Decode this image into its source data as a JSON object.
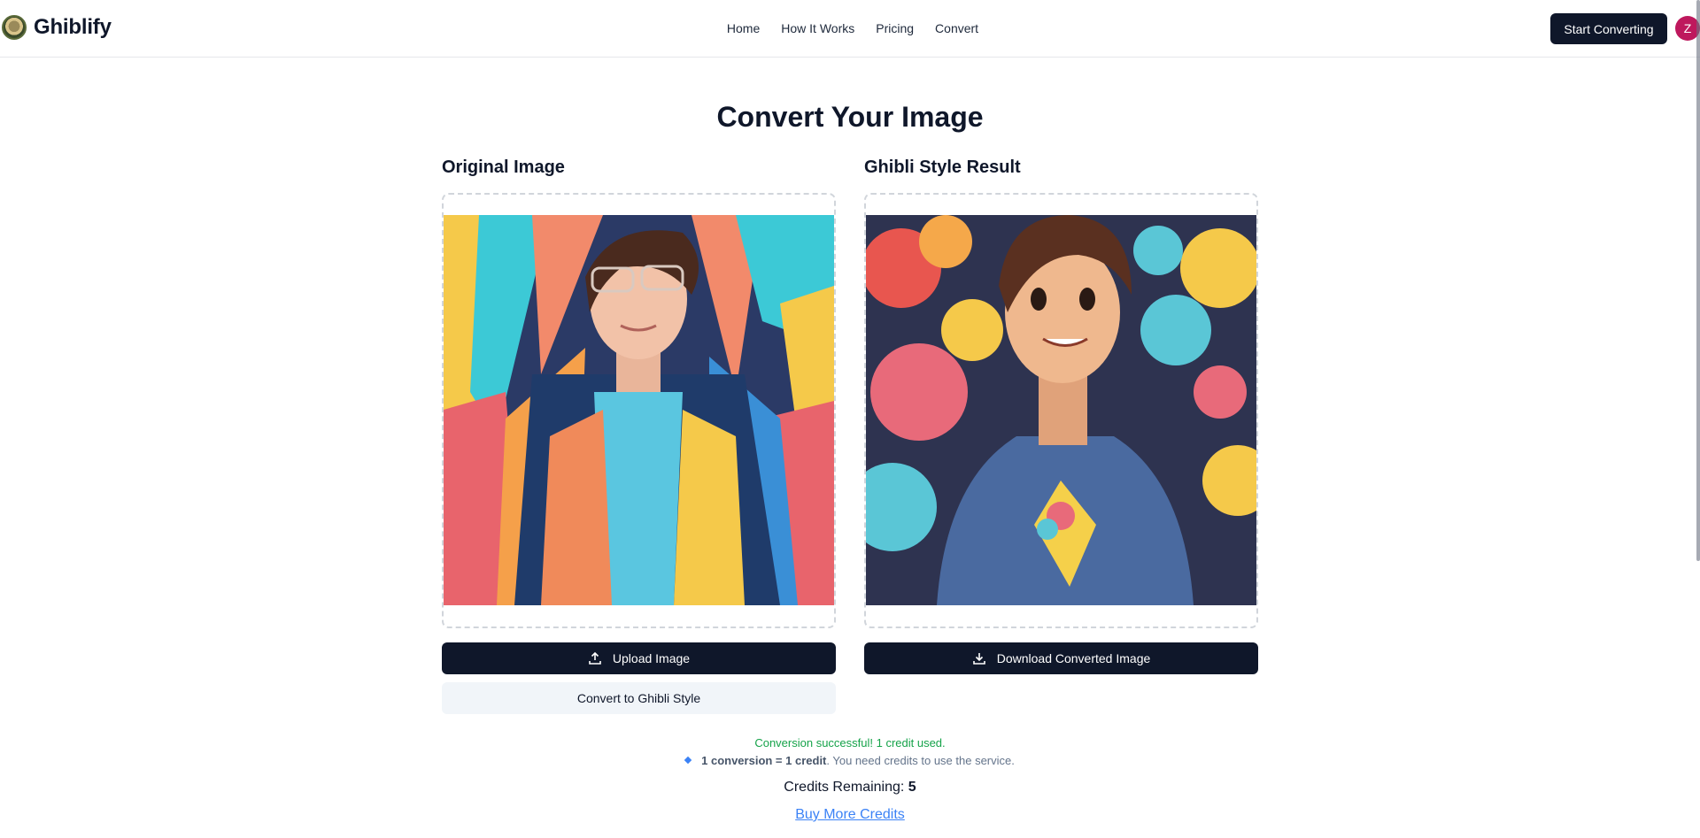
{
  "header": {
    "brand": "Ghiblify",
    "nav": [
      "Home",
      "How It Works",
      "Pricing",
      "Convert"
    ],
    "cta_label": "Start Converting",
    "avatar_initial": "Z"
  },
  "main": {
    "title": "Convert Your Image",
    "original": {
      "title": "Original Image",
      "upload_label": "Upload Image",
      "convert_label": "Convert to Ghibli Style"
    },
    "result": {
      "title": "Ghibli Style Result",
      "download_label": "Download Converted Image"
    },
    "status_success": "Conversion successful! 1 credit used.",
    "info": {
      "bold": "1 conversion = 1 credit",
      "rest": ". You need credits to use the service."
    },
    "credits_label": "Credits Remaining:",
    "credits_value": "5",
    "buy_label": "Buy More Credits"
  },
  "colors": {
    "primary": "#0f172a",
    "success": "#16a34a",
    "link": "#3b82f6",
    "avatar": "#be185d"
  }
}
